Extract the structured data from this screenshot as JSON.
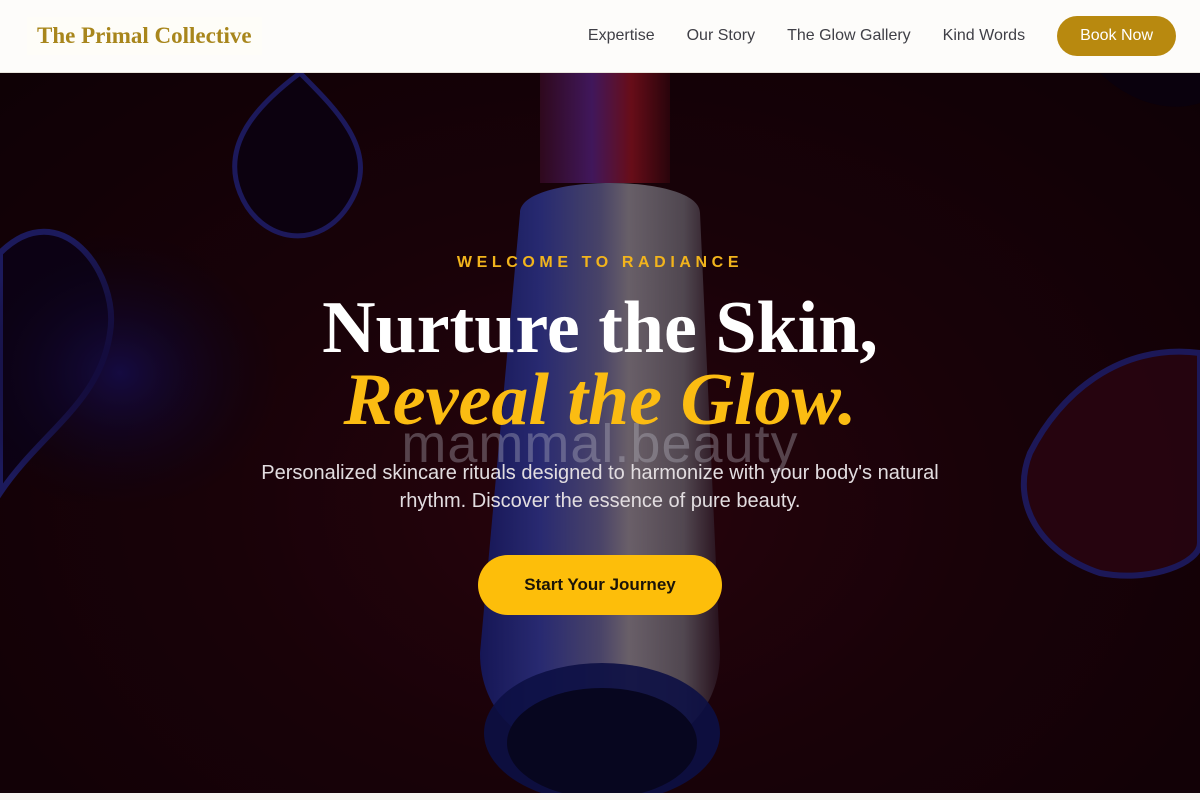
{
  "nav": {
    "brand": "The Primal Collective",
    "links": [
      "Expertise",
      "Our Story",
      "The Glow Gallery",
      "Kind Words"
    ],
    "book_label": "Book Now"
  },
  "hero": {
    "eyebrow": "WELCOME TO RADIANCE",
    "headline_line1": "Nurture the Skin,",
    "headline_line2": "Reveal the Glow.",
    "watermark": "mammal.beauty",
    "subtitle": "Personalized skincare rituals designed to harmonize with your body's natural rhythm. Discover the essence of pure beauty.",
    "cta_label": "Start Your Journey"
  },
  "colors": {
    "brand_gold": "#a8861c",
    "button_gold": "#b8890f",
    "accent_yellow": "#fbbc12",
    "hero_background": "#22040b"
  }
}
